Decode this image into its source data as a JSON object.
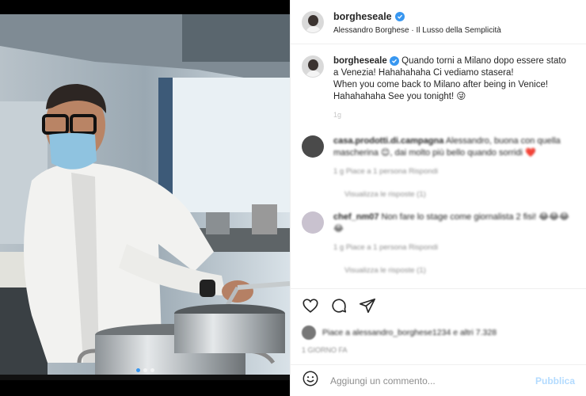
{
  "post": {
    "username": "borgheseale",
    "subtitle": "Alessandro Borghese · Il Lusso della Semplicità",
    "caption_it": "Quando torni a Milano dopo essere stato a Venezia! Hahahahaha Ci vediamo stasera!",
    "caption_en": "When you come back to Milano after being in Venice! Hahahahaha See you tonight! 😜",
    "caption_time": "1g"
  },
  "comments": [
    {
      "username": "casa.prodotti.di.campagna",
      "text": "Alessandro, buona con quella mascherina 😊, dai molto più bello quando sorridi ❤️",
      "meta": "1 g   Piace a 1 persona   Rispondi",
      "replies": "Visualizza le risposte (1)"
    },
    {
      "username": "chef_nm07",
      "text": "Non fare lo stage come giornalista 2 fisi! 😂😂😂😂",
      "meta": "1 g   Piace a 1 persona   Rispondi",
      "replies": "Visualizza le risposte (1)"
    }
  ],
  "likes": {
    "text": "Piace a alessandro_borghese1234 e altri 7.328",
    "ago": "1 GIORNO FA"
  },
  "compose": {
    "placeholder": "Aggiungi un commento...",
    "post_label": "Pubblica"
  },
  "icons": {
    "like": "heart-icon",
    "comment": "comment-icon",
    "share": "share-icon",
    "emoji": "emoji-icon",
    "verified": "verified-badge-icon"
  },
  "colors": {
    "accent": "#3897f0",
    "post_disabled": "#b3dbff",
    "muted": "#8e8e8e"
  },
  "carousel": {
    "total": 3,
    "active": 1
  }
}
